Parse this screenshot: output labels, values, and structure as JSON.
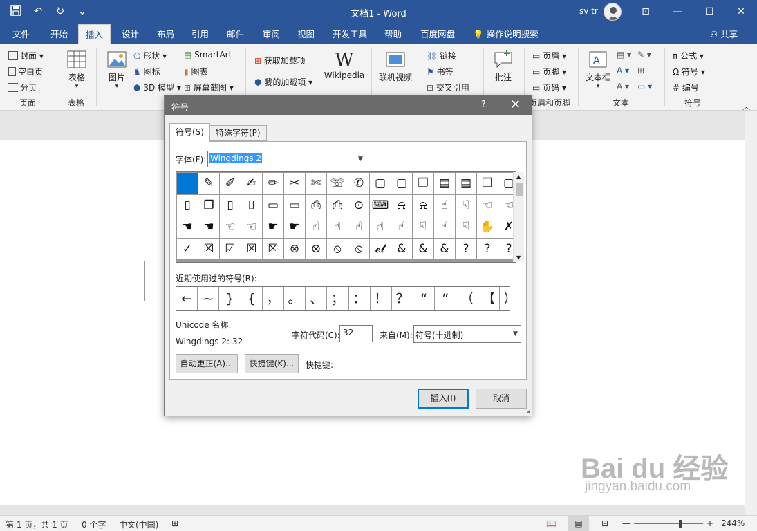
{
  "window": {
    "title": "文档1  -  Word",
    "user": "sv tr"
  },
  "qat": {
    "save_icon": "save-icon",
    "undo": "↶",
    "redo": "↻",
    "more": "⌄"
  },
  "window_buttons": {
    "ribbon_opts": "⊡",
    "minimize": "—",
    "maximize": "☐",
    "close": "✕"
  },
  "tabs": [
    "文件",
    "开始",
    "插入",
    "设计",
    "布局",
    "引用",
    "邮件",
    "审阅",
    "视图",
    "开发工具",
    "帮助",
    "百度网盘"
  ],
  "tell_me": "操作说明搜索",
  "share": "共享",
  "ribbon": {
    "pages": {
      "cover": "封面",
      "blank": "空白页",
      "break": "分页",
      "label": "页面"
    },
    "tables": {
      "table": "表格",
      "label": "表格"
    },
    "illustrations": {
      "picture": "图片",
      "shapes": "形状",
      "icons": "图标",
      "model3d": "3D 模型",
      "smartart": "SmartArt",
      "chart": "图表",
      "screenshot": "屏幕截图"
    },
    "addins": {
      "get": "获取加载项",
      "my": "我的加载项",
      "wiki": "Wikipedia",
      "wiki_glyph": "W"
    },
    "media": {
      "video": "联机视频"
    },
    "links": {
      "link": "链接",
      "bookmark": "书签",
      "xref": "交叉引用"
    },
    "comments": {
      "comment": "批注"
    },
    "header_footer": {
      "header": "页眉",
      "footer": "页脚",
      "page_num": "页码",
      "label": "页眉和页脚"
    },
    "text": {
      "textbox": "文本框",
      "label": "文本"
    },
    "symbols": {
      "equation": "公式",
      "symbol": "符号",
      "number": "编号",
      "label": "符号",
      "pi": "π",
      "omega": "Ω",
      "number_glyph": "#"
    }
  },
  "dialog": {
    "title": "符号",
    "help": "?",
    "close": "✕",
    "tabs": [
      "符号(S)",
      "特殊字符(P)"
    ],
    "font_label": "字体(F):",
    "font_value": "Wingdings 2",
    "symbols": [
      "",
      "✎",
      "✐",
      "✍",
      "✏",
      "✂",
      "✄",
      "☏",
      "✆",
      "▢",
      "▢",
      "❐",
      "▤",
      "▤",
      "❐",
      "▢",
      "▯",
      "❐",
      "▯",
      "⌷",
      "▭",
      "▭",
      "⎙",
      "⎙",
      "⊙",
      "⌨",
      "⍾",
      "⍾",
      "☝",
      "☟",
      "☜",
      "☜",
      "☚",
      "☚",
      "☜",
      "☜",
      "☛",
      "☛",
      "☝",
      "☝",
      "☝",
      "☝",
      "☝",
      "☟",
      "☝",
      "☟",
      "✋",
      "✗",
      "✓",
      "☒",
      "☑",
      "☒",
      "☒",
      "⊗",
      "⊗",
      "⦸",
      "⦸",
      "𝓮𝓽",
      "&",
      "&",
      "&",
      "?",
      "?",
      "?"
    ],
    "recent_label": "近期使用过的符号(R):",
    "recent": [
      "←",
      "~",
      "}",
      "{",
      "，",
      "。",
      "、",
      "；",
      "：",
      "！",
      "？",
      "“",
      "”",
      "（",
      "【",
      "）"
    ],
    "unicode_label": "Unicode 名称:",
    "unicode_value": "Wingdings 2: 32",
    "code_label": "字符代码(C):",
    "code_value": "32",
    "from_label": "来自(M):",
    "from_value": "符号(十进制)",
    "autocorrect": "自动更正(A)...",
    "shortcut_btn": "快捷键(K)...",
    "shortcut_label": "快捷键:",
    "insert": "插入(I)",
    "cancel": "取消"
  },
  "status": {
    "page": "第 1 页，共 1 页",
    "words": "0 个字",
    "lang": "中文(中国)",
    "zoom": "244%",
    "minus": "—",
    "plus": "+"
  },
  "watermark": {
    "brand": "Bai du 经验",
    "url": "jingyan.baidu.com"
  }
}
